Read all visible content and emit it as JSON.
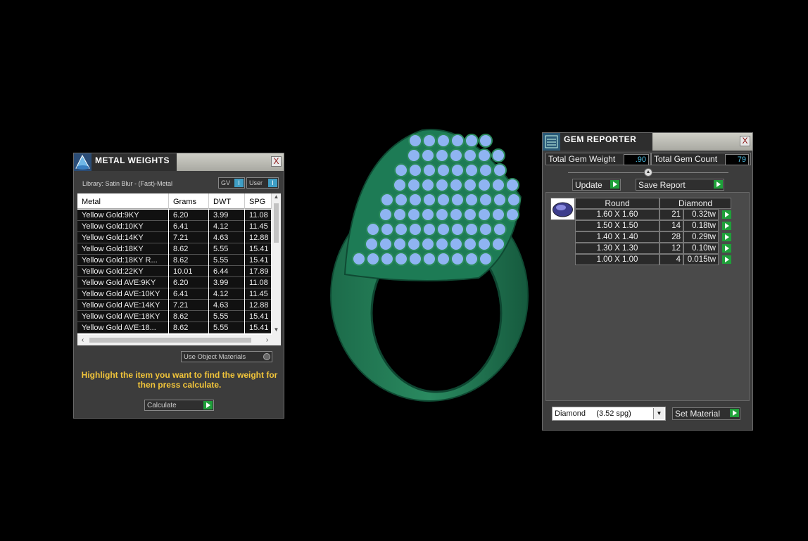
{
  "metal_weights": {
    "title": "METAL WEIGHTS",
    "close": "X",
    "library_label": "Library: Satin Blur - (Fast)-Metal",
    "toggle_gv": "GV",
    "toggle_user": "User",
    "toggle_mark": "I",
    "columns": [
      "Metal",
      "Grams",
      "DWT",
      "SPG"
    ],
    "rows": [
      [
        "Yellow Gold:9KY",
        "6.20",
        "3.99",
        "11.08"
      ],
      [
        "Yellow Gold:10KY",
        "6.41",
        "4.12",
        "11.45"
      ],
      [
        "Yellow Gold:14KY",
        "7.21",
        "4.63",
        "12.88"
      ],
      [
        "Yellow Gold:18KY",
        "8.62",
        "5.55",
        "15.41"
      ],
      [
        "Yellow Gold:18KY R...",
        "8.62",
        "5.55",
        "15.41"
      ],
      [
        "Yellow Gold:22KY",
        "10.01",
        "6.44",
        "17.89"
      ],
      [
        "Yellow Gold AVE:9KY",
        "6.20",
        "3.99",
        "11.08"
      ],
      [
        "Yellow Gold AVE:10KY",
        "6.41",
        "4.12",
        "11.45"
      ],
      [
        "Yellow Gold AVE:14KY",
        "7.21",
        "4.63",
        "12.88"
      ],
      [
        "Yellow Gold AVE:18KY",
        "8.62",
        "5.55",
        "15.41"
      ],
      [
        "Yellow Gold AVE:18...",
        "8.62",
        "5.55",
        "15.41"
      ]
    ],
    "use_object_materials": "Use Object Materials",
    "hint": "Highlight the item you want to find the weight for then press calculate.",
    "calculate": "Calculate"
  },
  "gem_reporter": {
    "title": "GEM REPORTER",
    "close": "X",
    "total_gem_weight_label": "Total Gem Weight",
    "total_gem_weight": ".90",
    "total_gem_count_label": "Total Gem Count",
    "total_gem_count": "79",
    "update": "Update",
    "save_report": "Save Report",
    "header_shape": "Round",
    "header_material": "Diamond",
    "gems": [
      {
        "size": "1.60 X 1.60",
        "count": "21",
        "weight": "0.32tw"
      },
      {
        "size": "1.50 X 1.50",
        "count": "14",
        "weight": "0.18tw"
      },
      {
        "size": "1.40 X 1.40",
        "count": "28",
        "weight": "0.29tw"
      },
      {
        "size": "1.30 X 1.30",
        "count": "12",
        "weight": "0.10tw"
      },
      {
        "size": "1.00 X 1.00",
        "count": "4",
        "weight": "0.015tw"
      }
    ],
    "material_select": "Diamond     (3.52 spg)",
    "set_material": "Set Material"
  },
  "colors": {
    "ring_green": "#1e7a55",
    "gem_blue": "#8fb4f2",
    "hint_yellow": "#f2c53a",
    "accent_green": "#1fa03a",
    "value_cyan": "#4fc3e8"
  }
}
